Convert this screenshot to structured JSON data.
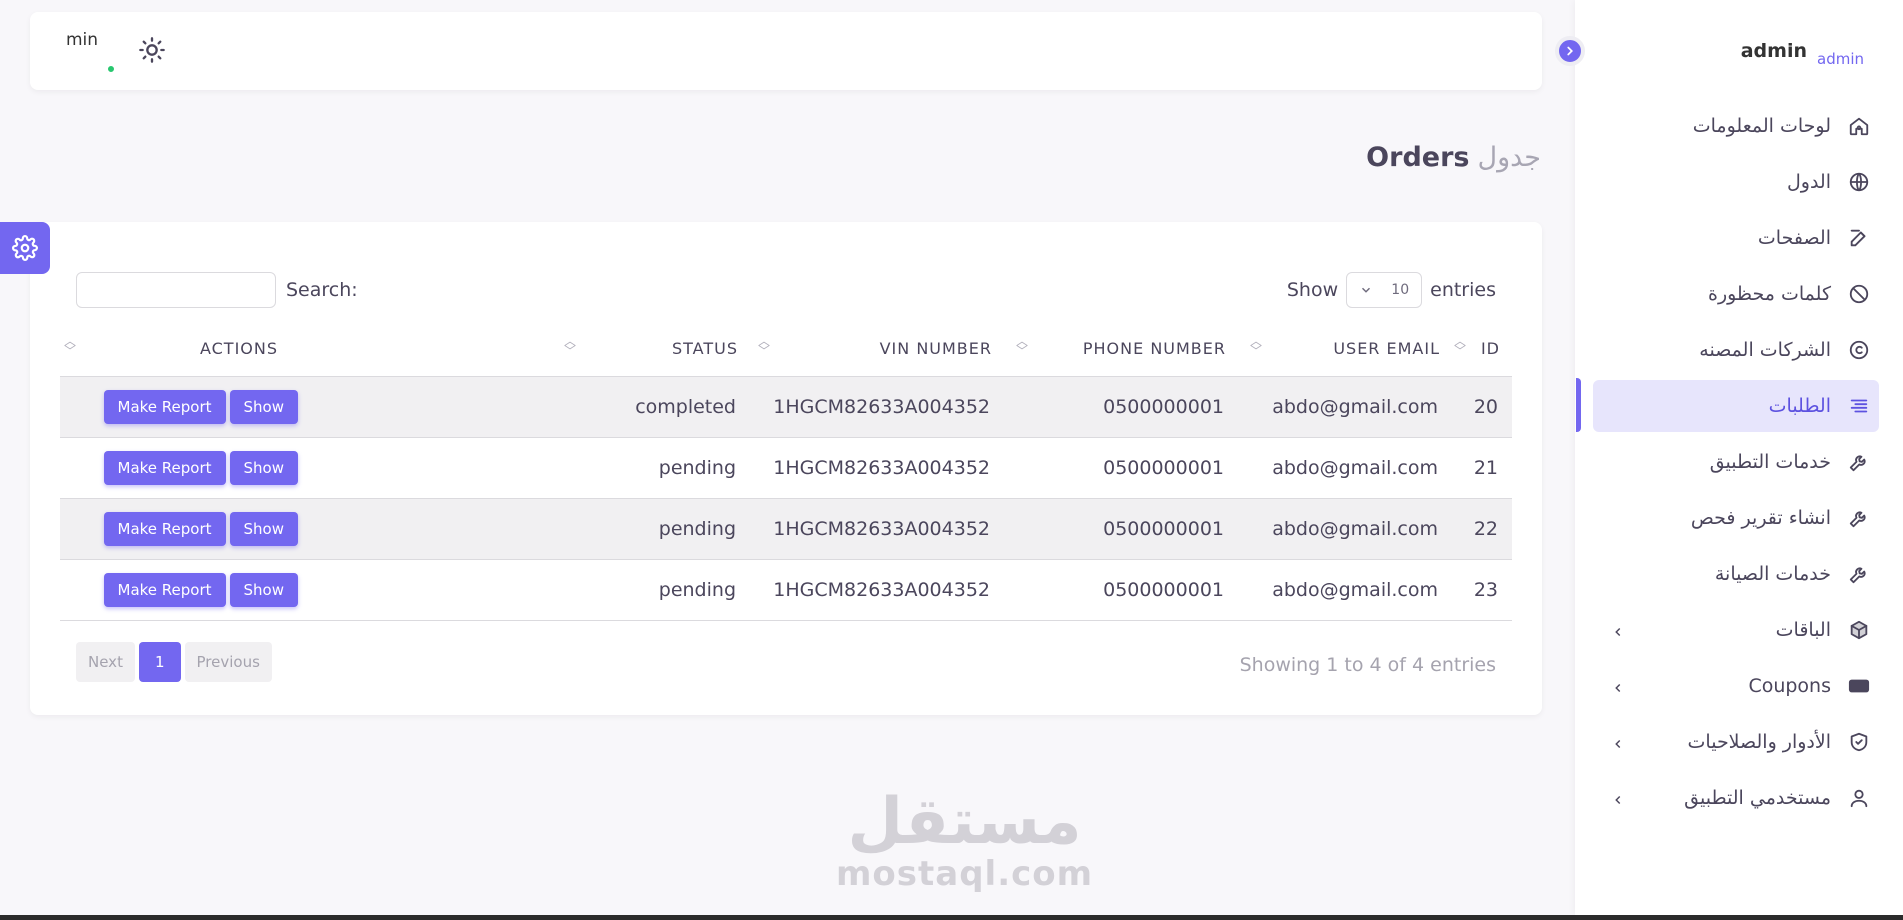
{
  "brand": {
    "name": "admin",
    "logo_alt": "admin"
  },
  "navbar": {
    "avatar_alt": "min"
  },
  "page_title": {
    "prefix": "جدول",
    "title": "Orders"
  },
  "colors": {
    "primary": "#7367f0",
    "active_bg": "#e7e5fc",
    "online": "#28c76f"
  },
  "sidebar": {
    "items": [
      {
        "label": "لوحات المعلومات",
        "icon": "home-icon"
      },
      {
        "label": "الدول",
        "icon": "globe-icon"
      },
      {
        "label": "الصفحات",
        "icon": "edit-icon"
      },
      {
        "label": "كلمات محظورة",
        "icon": "ban-icon"
      },
      {
        "label": "الشركات المصنه",
        "icon": "copyright-icon"
      },
      {
        "label": "الطلبات",
        "icon": "list-icon",
        "active": true
      },
      {
        "label": "خدمات التطبيق",
        "icon": "wrench-icon"
      },
      {
        "label": "انشاء تقرير فحص",
        "icon": "wrench-icon"
      },
      {
        "label": "خدمات الصيانة",
        "icon": "wrench-icon"
      },
      {
        "label": "الباقات",
        "icon": "box-icon",
        "has_children": true
      },
      {
        "label": "Coupons",
        "icon": "ticket-icon",
        "has_children": true
      },
      {
        "label": "الأدوار والصلاحيات",
        "icon": "shield-icon",
        "has_children": true
      },
      {
        "label": "مستخدمي التطبيق",
        "icon": "user-icon",
        "has_children": true
      }
    ]
  },
  "table_controls": {
    "show_label": "Show",
    "entries_label": "entries",
    "page_size": "10",
    "search_label": "Search:"
  },
  "table": {
    "columns": [
      "ID",
      "USER EMAIL",
      "PHONE NUMBER",
      "VIN NUMBER",
      "STATUS",
      "ACTIONS"
    ],
    "rows": [
      {
        "id": "20",
        "email": "abdo@gmail.com",
        "phone": "0500000001",
        "vin": "1HGCM82633A004352",
        "status": "completed"
      },
      {
        "id": "21",
        "email": "abdo@gmail.com",
        "phone": "0500000001",
        "vin": "1HGCM82633A004352",
        "status": "pending"
      },
      {
        "id": "22",
        "email": "abdo@gmail.com",
        "phone": "0500000001",
        "vin": "1HGCM82633A004352",
        "status": "pending"
      },
      {
        "id": "23",
        "email": "abdo@gmail.com",
        "phone": "0500000001",
        "vin": "1HGCM82633A004352",
        "status": "pending"
      }
    ],
    "make_report_label": "Make Report",
    "show_label": "Show"
  },
  "footer": {
    "info": "Showing 1 to 4 of 4 entries",
    "next": "Next",
    "current_page": "1",
    "previous": "Previous"
  },
  "watermark": {
    "arabic": "مستقل",
    "latin": "mostaql.com"
  }
}
